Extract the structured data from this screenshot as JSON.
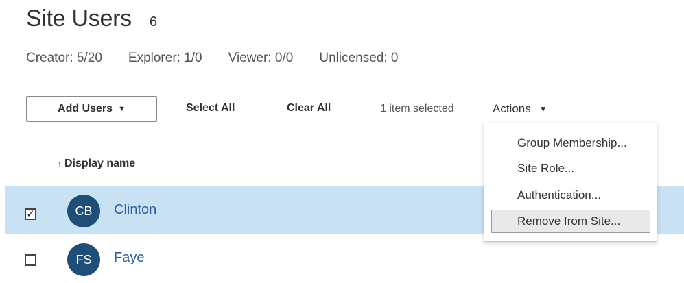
{
  "page": {
    "title": "Site Users",
    "count": "6"
  },
  "licenses": {
    "creator": "Creator: 5/20",
    "explorer": "Explorer: 1/0",
    "viewer": "Viewer: 0/0",
    "unlicensed": "Unlicensed: 0"
  },
  "toolbar": {
    "add_users": "Add Users",
    "select_all": "Select All",
    "clear_all": "Clear All",
    "selection_status": "1 item selected",
    "actions": "Actions"
  },
  "table": {
    "sort_indicator": "↑",
    "column_display_name": "Display name",
    "rows": [
      {
        "initials": "CB",
        "name": "Clinton",
        "checked": "✓",
        "selected": true
      },
      {
        "initials": "FS",
        "name": "Faye",
        "checked": "",
        "selected": false
      }
    ]
  },
  "actions_menu": {
    "items": [
      "Group Membership...",
      "Site Role...",
      "Authentication...",
      "Remove from Site..."
    ]
  },
  "colors": {
    "avatar": "#1f4e79",
    "selected_row": "#c9e2f3",
    "link": "#2e5fa0"
  },
  "icons": {
    "dropdown": "caret-down-icon",
    "sort": "sort-ascending-icon",
    "check": "checkmark-icon"
  }
}
